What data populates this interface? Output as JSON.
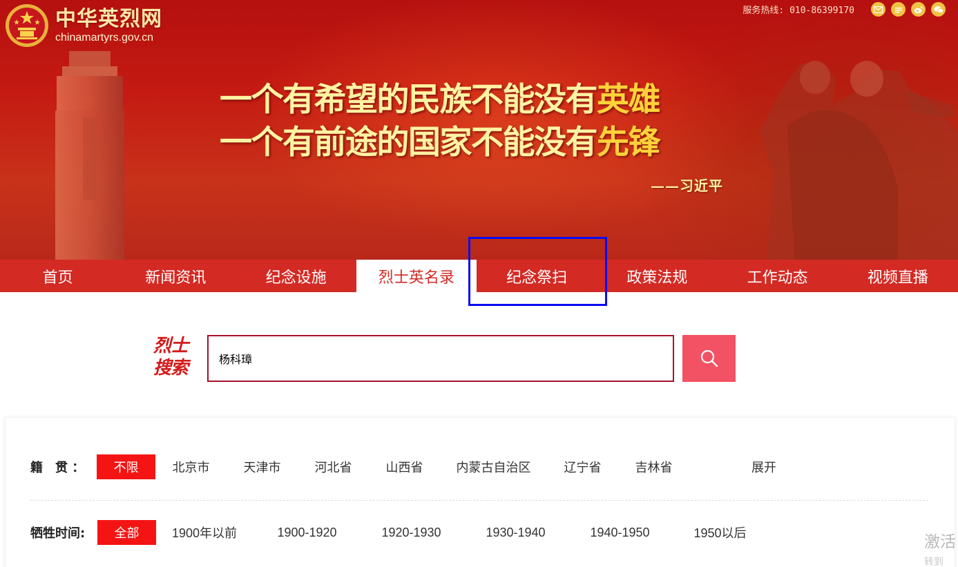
{
  "header": {
    "logo_cn": "中华英烈网",
    "logo_url": "chinamartyrs.gov.cn",
    "hotline": "服务热线: 010-86399170",
    "social_icons": [
      "mail-icon",
      "toutiao-icon",
      "weibo-icon",
      "wechat-icon"
    ]
  },
  "banner": {
    "slogan_line1_main": "一个有希望的民族不能没有",
    "slogan_line1_hl": "英雄",
    "slogan_line2_main": "一个有前途的国家不能没有",
    "slogan_line2_hl": "先锋",
    "attribution": "——习近平"
  },
  "nav": {
    "items": [
      {
        "label": "首页"
      },
      {
        "label": "新闻资讯"
      },
      {
        "label": "纪念设施"
      },
      {
        "label": "烈士英名录"
      },
      {
        "label": "纪念祭扫"
      },
      {
        "label": "政策法规"
      },
      {
        "label": "工作动态"
      },
      {
        "label": "视频直播"
      }
    ],
    "active": "烈士英名录"
  },
  "search": {
    "title_line1": "烈士",
    "title_line2": "搜索",
    "value": "杨科璋"
  },
  "filters": {
    "origin": {
      "label": "籍　贯 ：",
      "options": [
        "不限",
        "北京市",
        "天津市",
        "河北省",
        "山西省",
        "内蒙古自治区",
        "辽宁省",
        "吉林省"
      ],
      "expand": "展开"
    },
    "sacrifice_time": {
      "label": "牺牲时间:",
      "options": [
        "全部",
        "1900年以前",
        "1900-1920",
        "1920-1930",
        "1930-1940",
        "1940-1950",
        "1950以后"
      ]
    }
  },
  "watermark": {
    "line1": "激活",
    "line2": "转到"
  },
  "colors": {
    "nav_bg": "#d42a24",
    "selected_option": "#f51414",
    "search_button": "#f25264",
    "highlight_box": "#0b0bf2"
  }
}
